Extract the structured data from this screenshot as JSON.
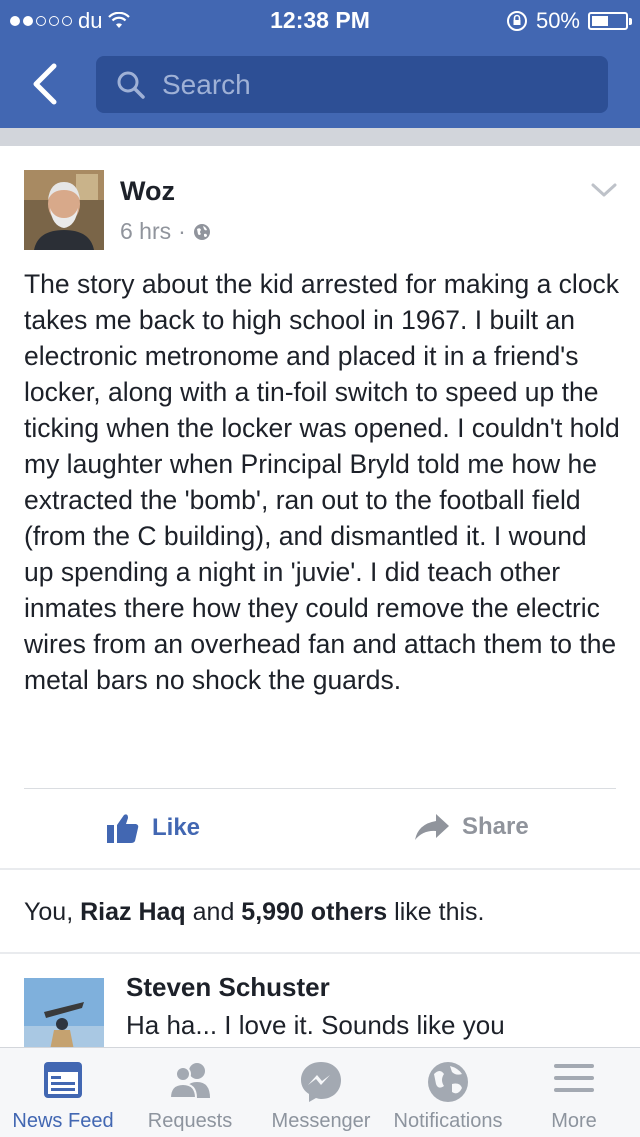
{
  "status_bar": {
    "carrier": "du",
    "time": "12:38 PM",
    "battery": "50%",
    "battery_level": 0.5
  },
  "header": {
    "search_placeholder": "Search"
  },
  "post": {
    "author": "Woz",
    "time": "6 hrs",
    "text": "The story about the kid arrested for making a clock takes me back to high school in 1967. I built an electronic metronome and placed it in a friend's locker, along with a tin-foil switch to speed up the ticking when the locker was opened. I couldn't hold my laughter when Principal Bryld told me how he extracted the 'bomb', ran out to the football field (from the C building), and dismantled it. I wound up spending a night in 'juvie'. I did teach other inmates there how they could remove the electric wires from an overhead fan and attach them to the metal bars no shock the guards.",
    "like_label": "Like",
    "share_label": "Share"
  },
  "likes_summary": {
    "prefix": "You, ",
    "name": "Riaz Haq",
    "middle": " and ",
    "others": "5,990 others",
    "suffix": " like this."
  },
  "comment": {
    "author": "Steven Schuster",
    "text": "Ha ha... I love it.  Sounds like you"
  },
  "tabs": [
    {
      "label": "News Feed",
      "icon": "news-feed-icon",
      "active": true
    },
    {
      "label": "Requests",
      "icon": "requests-icon"
    },
    {
      "label": "Messenger",
      "icon": "messenger-icon"
    },
    {
      "label": "Notifications",
      "icon": "globe-icon"
    },
    {
      "label": "More",
      "icon": "menu-icon"
    }
  ],
  "colors": {
    "brand": "#4267b2",
    "inactive": "#8d949e",
    "text": "#1d2129"
  }
}
